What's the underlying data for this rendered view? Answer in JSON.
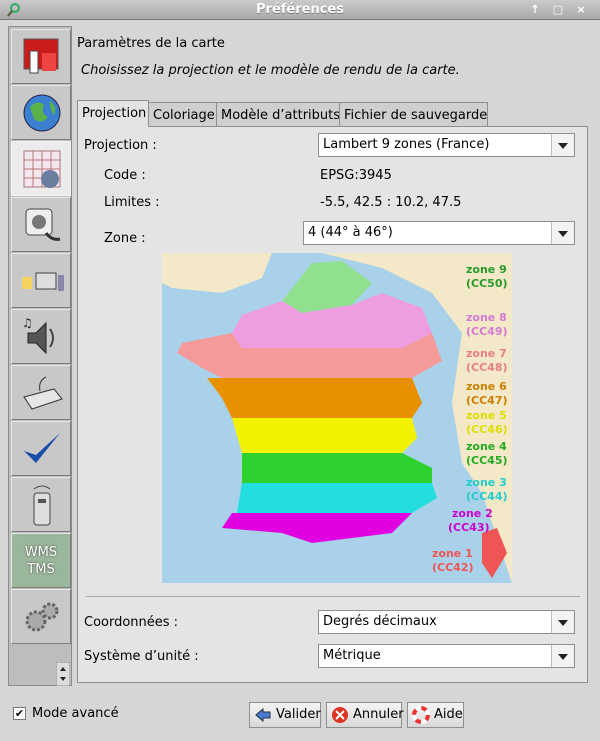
{
  "window": {
    "title": "Préférences"
  },
  "header": {
    "title": "Paramètres de la carte",
    "subtitle": "Choisissez la projection et le modèle de rendu de la carte."
  },
  "sidebar": {
    "items": [
      {
        "icon": "paint-icon"
      },
      {
        "icon": "globe-icon"
      },
      {
        "icon": "map-grid-icon",
        "selected": true
      },
      {
        "icon": "power-plug-icon"
      },
      {
        "icon": "folders-icon"
      },
      {
        "icon": "speaker-icon"
      },
      {
        "icon": "keyboard-icon"
      },
      {
        "icon": "checkmark-icon"
      },
      {
        "icon": "remote-control-icon"
      },
      {
        "icon": "wms-tms-icon",
        "label_line1": "WMS",
        "label_line2": "TMS"
      },
      {
        "icon": "gears-icon"
      }
    ]
  },
  "tabs": [
    "Projection",
    "Coloriage",
    "Modèle d’attributs",
    "Fichier de sauvegarde"
  ],
  "projection": {
    "label": "Projection :",
    "value": "Lambert 9 zones (France)",
    "code_label": "Code :",
    "code_value": "EPSG:3945",
    "limits_label": "Limites :",
    "limits_value": "-5.5, 42.5 : 10.2, 47.5",
    "zone_label": "Zone :",
    "zone_value": "4 (44° à 46°)"
  },
  "map": {
    "zones": [
      {
        "name": "zone 9",
        "cc": "(CC50)",
        "color": "#6fbf6f"
      },
      {
        "name": "zone 8",
        "cc": "(CC49)",
        "color": "#e77fe7"
      },
      {
        "name": "zone 7",
        "cc": "(CC48)",
        "color": "#f08a8a"
      },
      {
        "name": "zone 6",
        "cc": "(CC47)",
        "color": "#d98a00"
      },
      {
        "name": "zone 5",
        "cc": "(CC46)",
        "color": "#e6e600"
      },
      {
        "name": "zone 4",
        "cc": "(CC45)",
        "color": "#22bb22"
      },
      {
        "name": "zone 3",
        "cc": "(CC44)",
        "color": "#22cccc"
      },
      {
        "name": "zone 2",
        "cc": "(CC43)",
        "color": "#cc00cc"
      },
      {
        "name": "zone 1",
        "cc": "(CC42)",
        "color": "#ee5555"
      }
    ]
  },
  "coordinates": {
    "label": "Coordonnées :",
    "value": "Degrés décimaux"
  },
  "units": {
    "label": "Système d’unité :",
    "value": "Métrique"
  },
  "footer": {
    "advanced_label": "Mode avancé",
    "advanced_checked": true,
    "validate": "Valider",
    "cancel": "Annuler",
    "help": "Aide"
  }
}
